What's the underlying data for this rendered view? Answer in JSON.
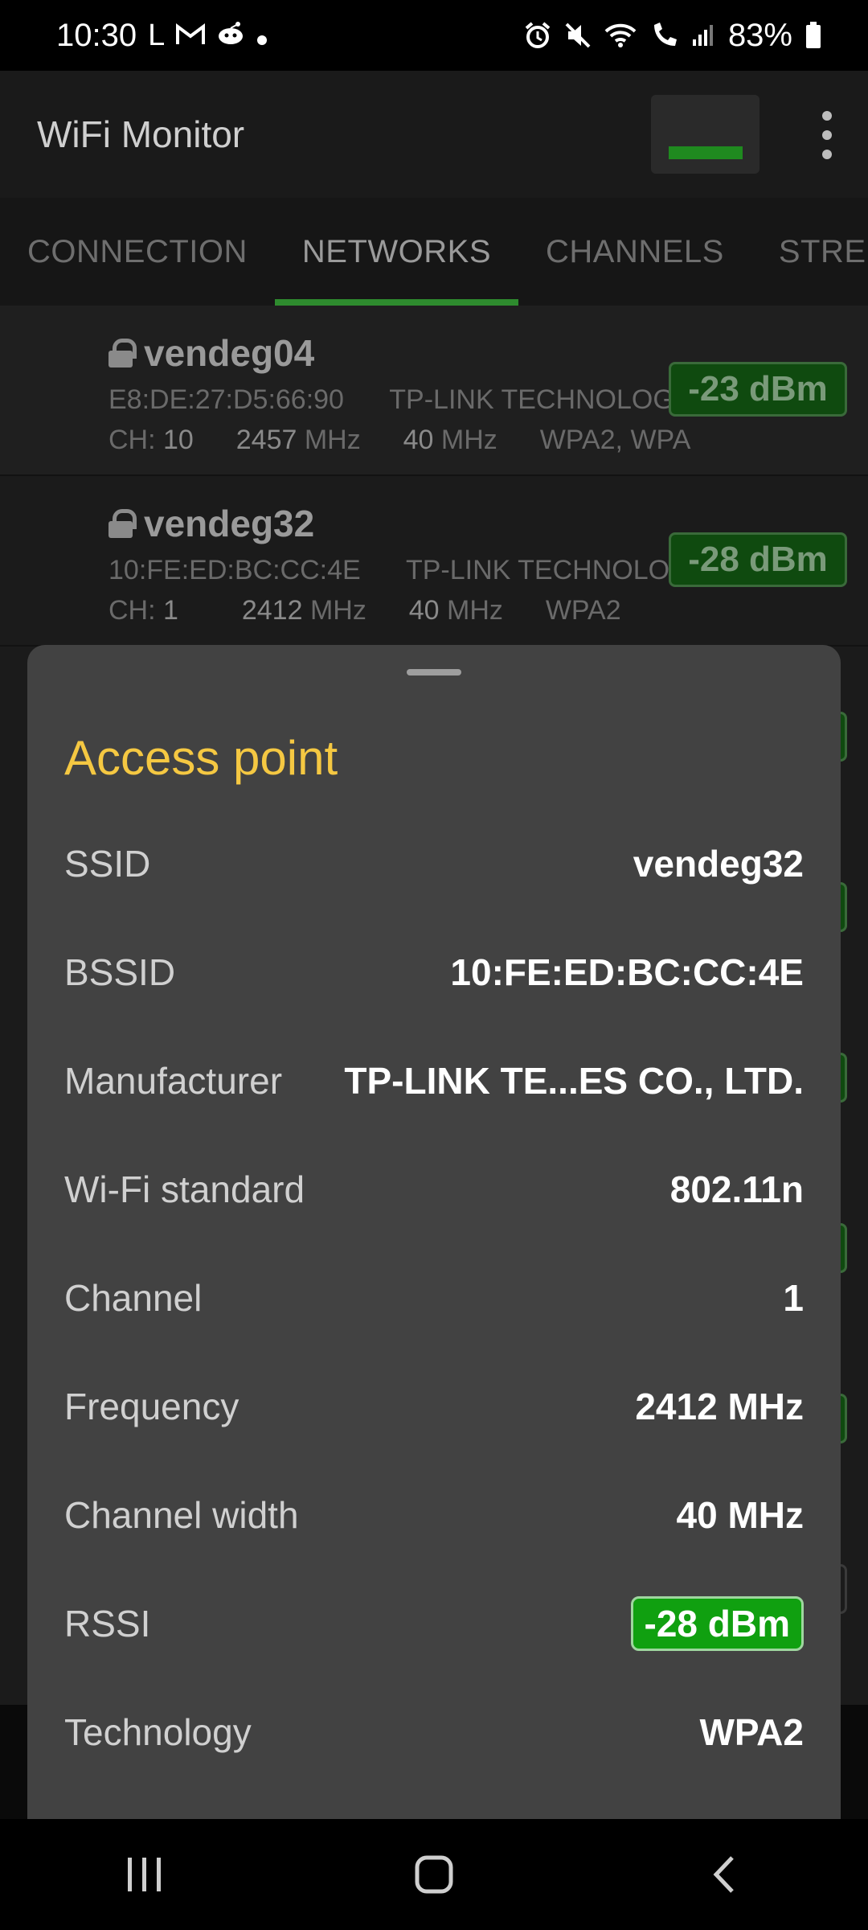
{
  "status": {
    "time": "10:30",
    "battery": "83%"
  },
  "app": {
    "title": "WiFi Monitor"
  },
  "tabs": [
    {
      "label": "CONNECTION"
    },
    {
      "label": "NETWORKS"
    },
    {
      "label": "CHANNELS"
    },
    {
      "label": "STREN"
    }
  ],
  "networks": [
    {
      "ssid": "vendeg04",
      "bssid": "E8:DE:27:D5:66:90",
      "vendor": "TP-LINK TECHNOLOGIE...",
      "ch_label": "CH:",
      "channel": "10",
      "freq": "2457",
      "freq_unit": "MHz",
      "width": "40",
      "width_unit": "MHz",
      "security": "WPA2, WPA",
      "rssi": "-23 dBm"
    },
    {
      "ssid": "vendeg32",
      "bssid": "10:FE:ED:BC:CC:4E",
      "vendor": "TP-LINK TECHNOLOGIE...",
      "ch_label": "CH:",
      "channel": "1",
      "freq": "2412",
      "freq_unit": "MHz",
      "width": "40",
      "width_unit": "MHz",
      "security": "WPA2",
      "rssi": "-28 dBm"
    }
  ],
  "sheet": {
    "title": "Access point",
    "rows": [
      {
        "label": "SSID",
        "value": "vendeg32"
      },
      {
        "label": "BSSID",
        "value": "10:FE:ED:BC:CC:4E"
      },
      {
        "label": "Manufacturer",
        "value": "TP-LINK TE...ES CO., LTD."
      },
      {
        "label": "Wi-Fi standard",
        "value": "802.11n"
      },
      {
        "label": "Channel",
        "value": "1"
      },
      {
        "label": "Frequency",
        "value": "2412 MHz"
      },
      {
        "label": "Channel width",
        "value": "40 MHz"
      },
      {
        "label": "RSSI",
        "value": "-28 dBm"
      },
      {
        "label": "Technology",
        "value": "WPA2"
      }
    ]
  },
  "colors": {
    "accent": "#2e8b2e",
    "sheet_title": "#f5c842",
    "rssi_badge": "#10a010",
    "sheet_bg": "#424242"
  },
  "icons": {
    "status_left": [
      "l-icon",
      "gmail-icon",
      "reddit-icon",
      "dot-icon"
    ],
    "status_right": [
      "alarm-icon",
      "mute-icon",
      "wifi-icon",
      "wifi-call-icon",
      "signal-icon",
      "battery-icon"
    ],
    "nav": [
      "recents-icon",
      "home-icon",
      "back-icon"
    ]
  }
}
